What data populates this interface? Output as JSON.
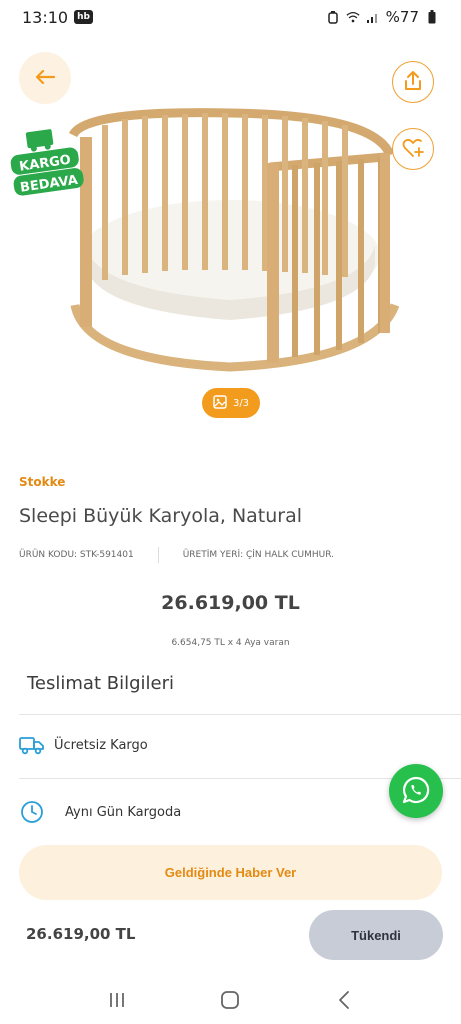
{
  "status_bar": {
    "time": "13:10",
    "app_badge": "hb",
    "battery": "%77"
  },
  "hero": {
    "badge_line1": "KARGO",
    "badge_line2": "BEDAVA",
    "image_counter": "3/3"
  },
  "product": {
    "brand": "Stokke",
    "title": "Sleepi Büyük Karyola, Natural",
    "code": "ÜRÜN KODU: STK-591401",
    "origin": "ÜRETİM YERİ: ÇİN HALK CUMHUR.",
    "price": "26.619,00 TL",
    "installment": "6.654,75 TL x 4 Aya varan"
  },
  "delivery": {
    "title": "Teslimat Bilgileri",
    "items": [
      {
        "label": "Ücretsiz Kargo",
        "icon": "truck-icon"
      },
      {
        "label": "Aynı Gün Kargoda",
        "icon": "clock-icon"
      }
    ]
  },
  "bottom": {
    "notify_label": "Geldiğinde Haber Ver",
    "price": "26.619,00 TL",
    "soldout_label": "Tükendi"
  },
  "colors": {
    "accent": "#f39b1c",
    "brand_text": "#e38a12",
    "whatsapp": "#28c04d",
    "badge_green": "#2ba84a"
  }
}
